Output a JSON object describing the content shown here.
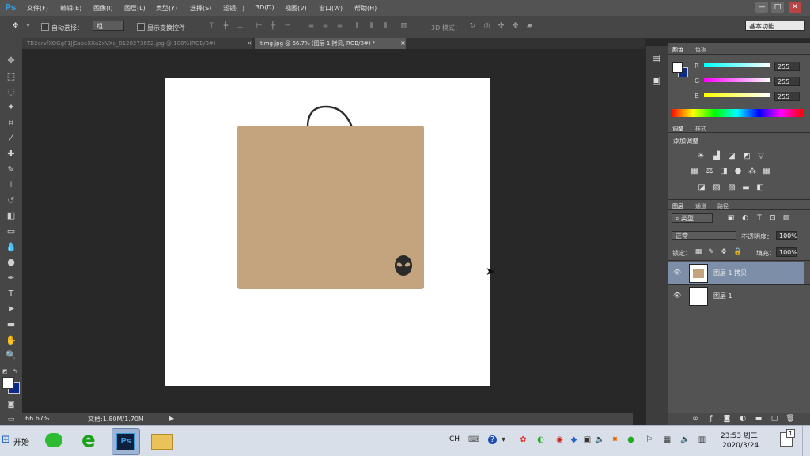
{
  "app": {
    "logo": "Ps",
    "menu": [
      "文件(F)",
      "编辑(E)",
      "图像(I)",
      "图层(L)",
      "类型(Y)",
      "选择(S)",
      "滤镜(T)",
      "3D(D)",
      "视图(V)",
      "窗口(W)",
      "帮助(H)"
    ],
    "window_buttons": [
      "—",
      "□",
      "✕"
    ]
  },
  "options": {
    "auto_select_label": "自动选择：",
    "auto_select_value": "组",
    "show_transform_label": "显示变换控件",
    "mode_3d_label": "3D 模式：",
    "workspace": "基本功能"
  },
  "tabs": [
    {
      "label": "TB2ervfXOGgF1JjSspeXXa2xVXa_8128273652.jpg @ 100%(RGB/8#)",
      "close": "×"
    },
    {
      "label": "timg.jpg @ 66.7% (图层 1 拷贝, RGB/8#) *",
      "close": "×"
    }
  ],
  "status": {
    "zoom": "66.67%",
    "doc": "文档:1.80M/1.70M",
    "arrow": "▶"
  },
  "colors": {
    "bag": "#c4a47e",
    "accent": "#3a9ad9"
  },
  "color_panel": {
    "tabs": [
      "颜色",
      "色板"
    ],
    "channels": [
      {
        "label": "R",
        "value": "255"
      },
      {
        "label": "G",
        "value": "255"
      },
      {
        "label": "B",
        "value": "255"
      }
    ]
  },
  "adjust_panel": {
    "tabs": [
      "调整",
      "样式"
    ],
    "title": "添加调整"
  },
  "layers_panel": {
    "tabs": [
      "图层",
      "通道",
      "路径"
    ],
    "filter_type": "类型",
    "blend_mode": "正常",
    "opacity_label": "不透明度：",
    "opacity": "100%",
    "lock_label": "锁定：",
    "fill_label": "填充：",
    "fill": "100%",
    "layers": [
      {
        "name": "图层 1 拷贝",
        "selected": true
      },
      {
        "name": "图层 1",
        "selected": false
      }
    ]
  },
  "taskbar": {
    "start": "开始",
    "lang": "CH",
    "time": "23:53 周二",
    "date": "2020/3/24",
    "notifications": "1"
  }
}
